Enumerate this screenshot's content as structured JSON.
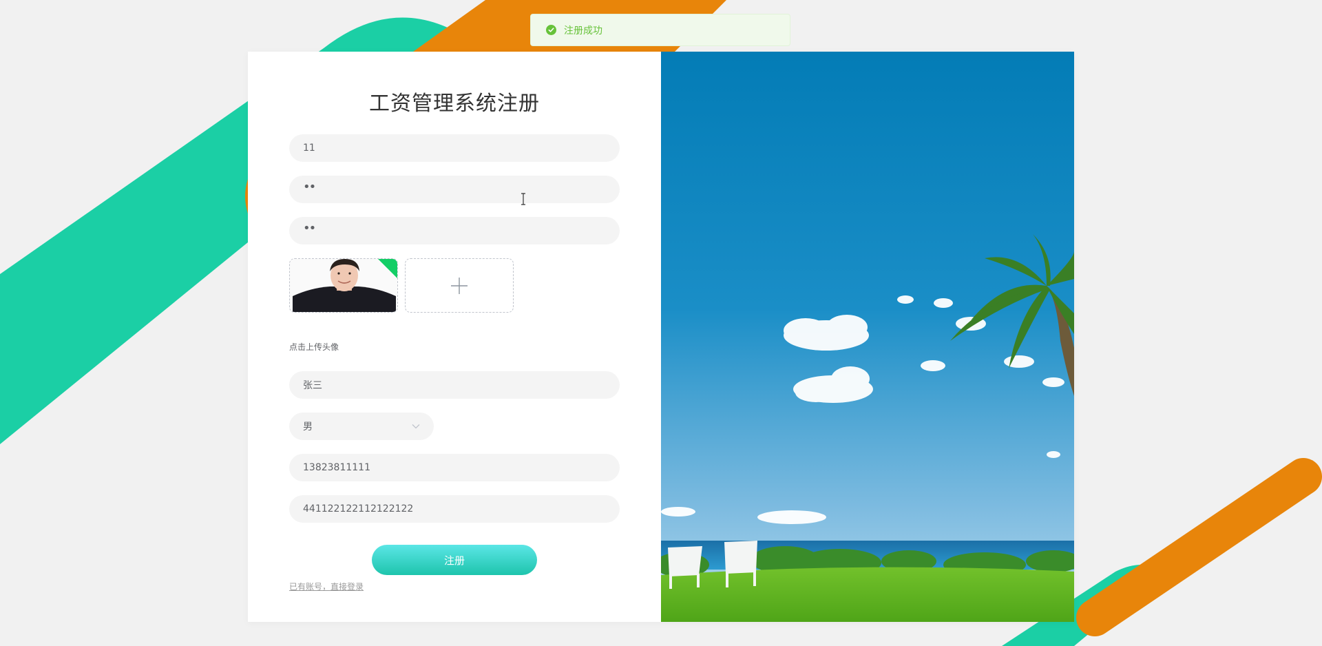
{
  "toast": {
    "message": "注册成功",
    "color": "#67c23a"
  },
  "form": {
    "title": "工资管理系统注册",
    "username_value": "11",
    "password_value": "••",
    "confirm_password_value": "••",
    "upload_hint": "点击上传头像",
    "name_value": "张三",
    "gender_value": "男",
    "phone_value": "13823811111",
    "id_card_value": "441122122112122122",
    "submit_label": "注册",
    "login_link": "已有账号，直接登录"
  },
  "colors": {
    "teal_stripe": "#1bcfa5",
    "orange_stripe": "#e8850a",
    "button_start": "#5be6e6",
    "button_end": "#1ec4ac",
    "sky": "#0a80b9",
    "grass": "#5fb41f"
  },
  "icons": {
    "toast": "check-circle-icon",
    "upload_add": "plus-icon",
    "select_arrow": "chevron-down-icon"
  }
}
